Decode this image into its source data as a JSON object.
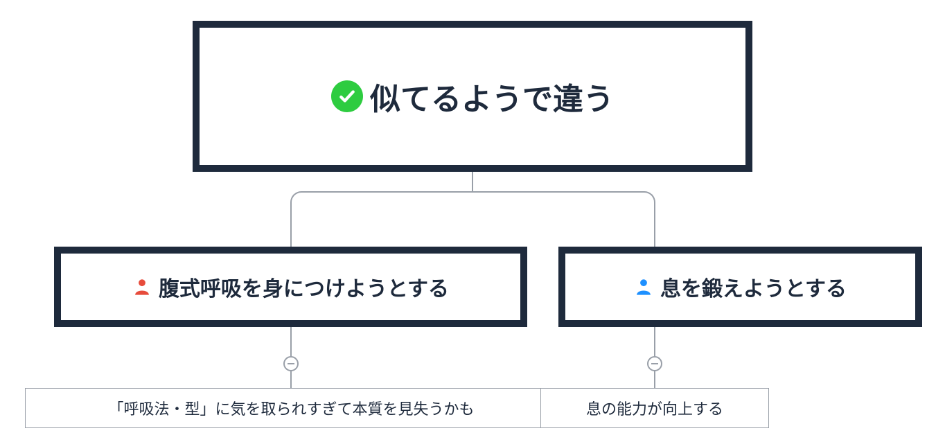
{
  "root": {
    "label": "似てるようで違う",
    "icon": "check-icon"
  },
  "branches": [
    {
      "label": "腹式呼吸を身につけようとする",
      "icon": "person-icon",
      "icon_color": "#e74c3c",
      "leaf": "「呼吸法・型」に気を取られすぎて本質を見失うかも"
    },
    {
      "label": "息を鍛えようとする",
      "icon": "person-icon",
      "icon_color": "#1e90ff",
      "leaf": "息の能力が向上する"
    }
  ],
  "colors": {
    "frame": "#1e2a3c",
    "connector": "#999fa8",
    "check_bg": "#2ecc40"
  }
}
